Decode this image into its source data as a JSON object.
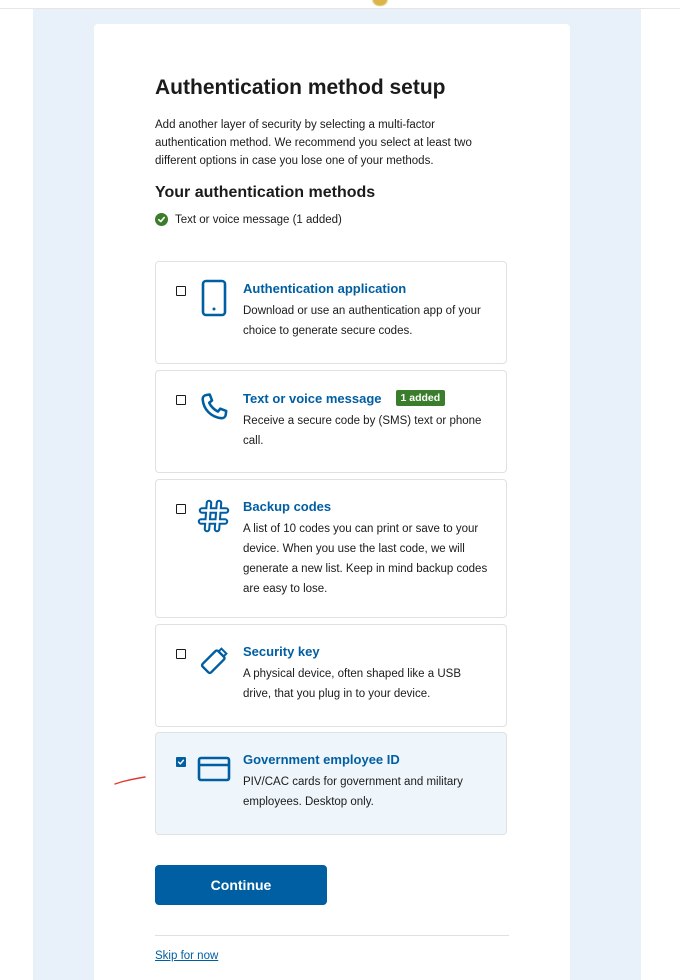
{
  "page": {
    "title": "Authentication method setup",
    "intro": "Add another layer of security by selecting a multi-factor authentication method. We recommend you select at least two different options in case you lose one of your methods.",
    "methods_heading": "Your authentication methods",
    "added_status": "Text or voice message (1 added)"
  },
  "options": [
    {
      "title": "Authentication application",
      "description": "Download or use an authentication app of your choice to generate secure codes.",
      "checked": false,
      "icon": "phone-device-icon"
    },
    {
      "title": "Text or voice message",
      "badge": "1 added",
      "description": "Receive a secure code by (SMS) text or phone call.",
      "checked": false,
      "icon": "phone-handset-icon"
    },
    {
      "title": "Backup codes",
      "description": "A list of 10 codes you can print or save to your device. When you use the last code, we will generate a new list. Keep in mind backup codes are easy to lose.",
      "checked": false,
      "icon": "hashtag-icon"
    },
    {
      "title": "Security key",
      "description": "A physical device, often shaped like a USB drive, that you plug in to your device.",
      "checked": false,
      "icon": "usb-key-icon"
    },
    {
      "title": "Government employee ID",
      "description": "PIV/CAC cards for government and military employees. Desktop only.",
      "checked": true,
      "icon": "id-card-icon"
    }
  ],
  "actions": {
    "continue_label": "Continue",
    "skip_label": "Skip for now"
  },
  "colors": {
    "accent": "#005ea2",
    "success": "#3a7d2a",
    "backdrop": "#e8f0f9",
    "selected_bg": "#eff6fb"
  }
}
